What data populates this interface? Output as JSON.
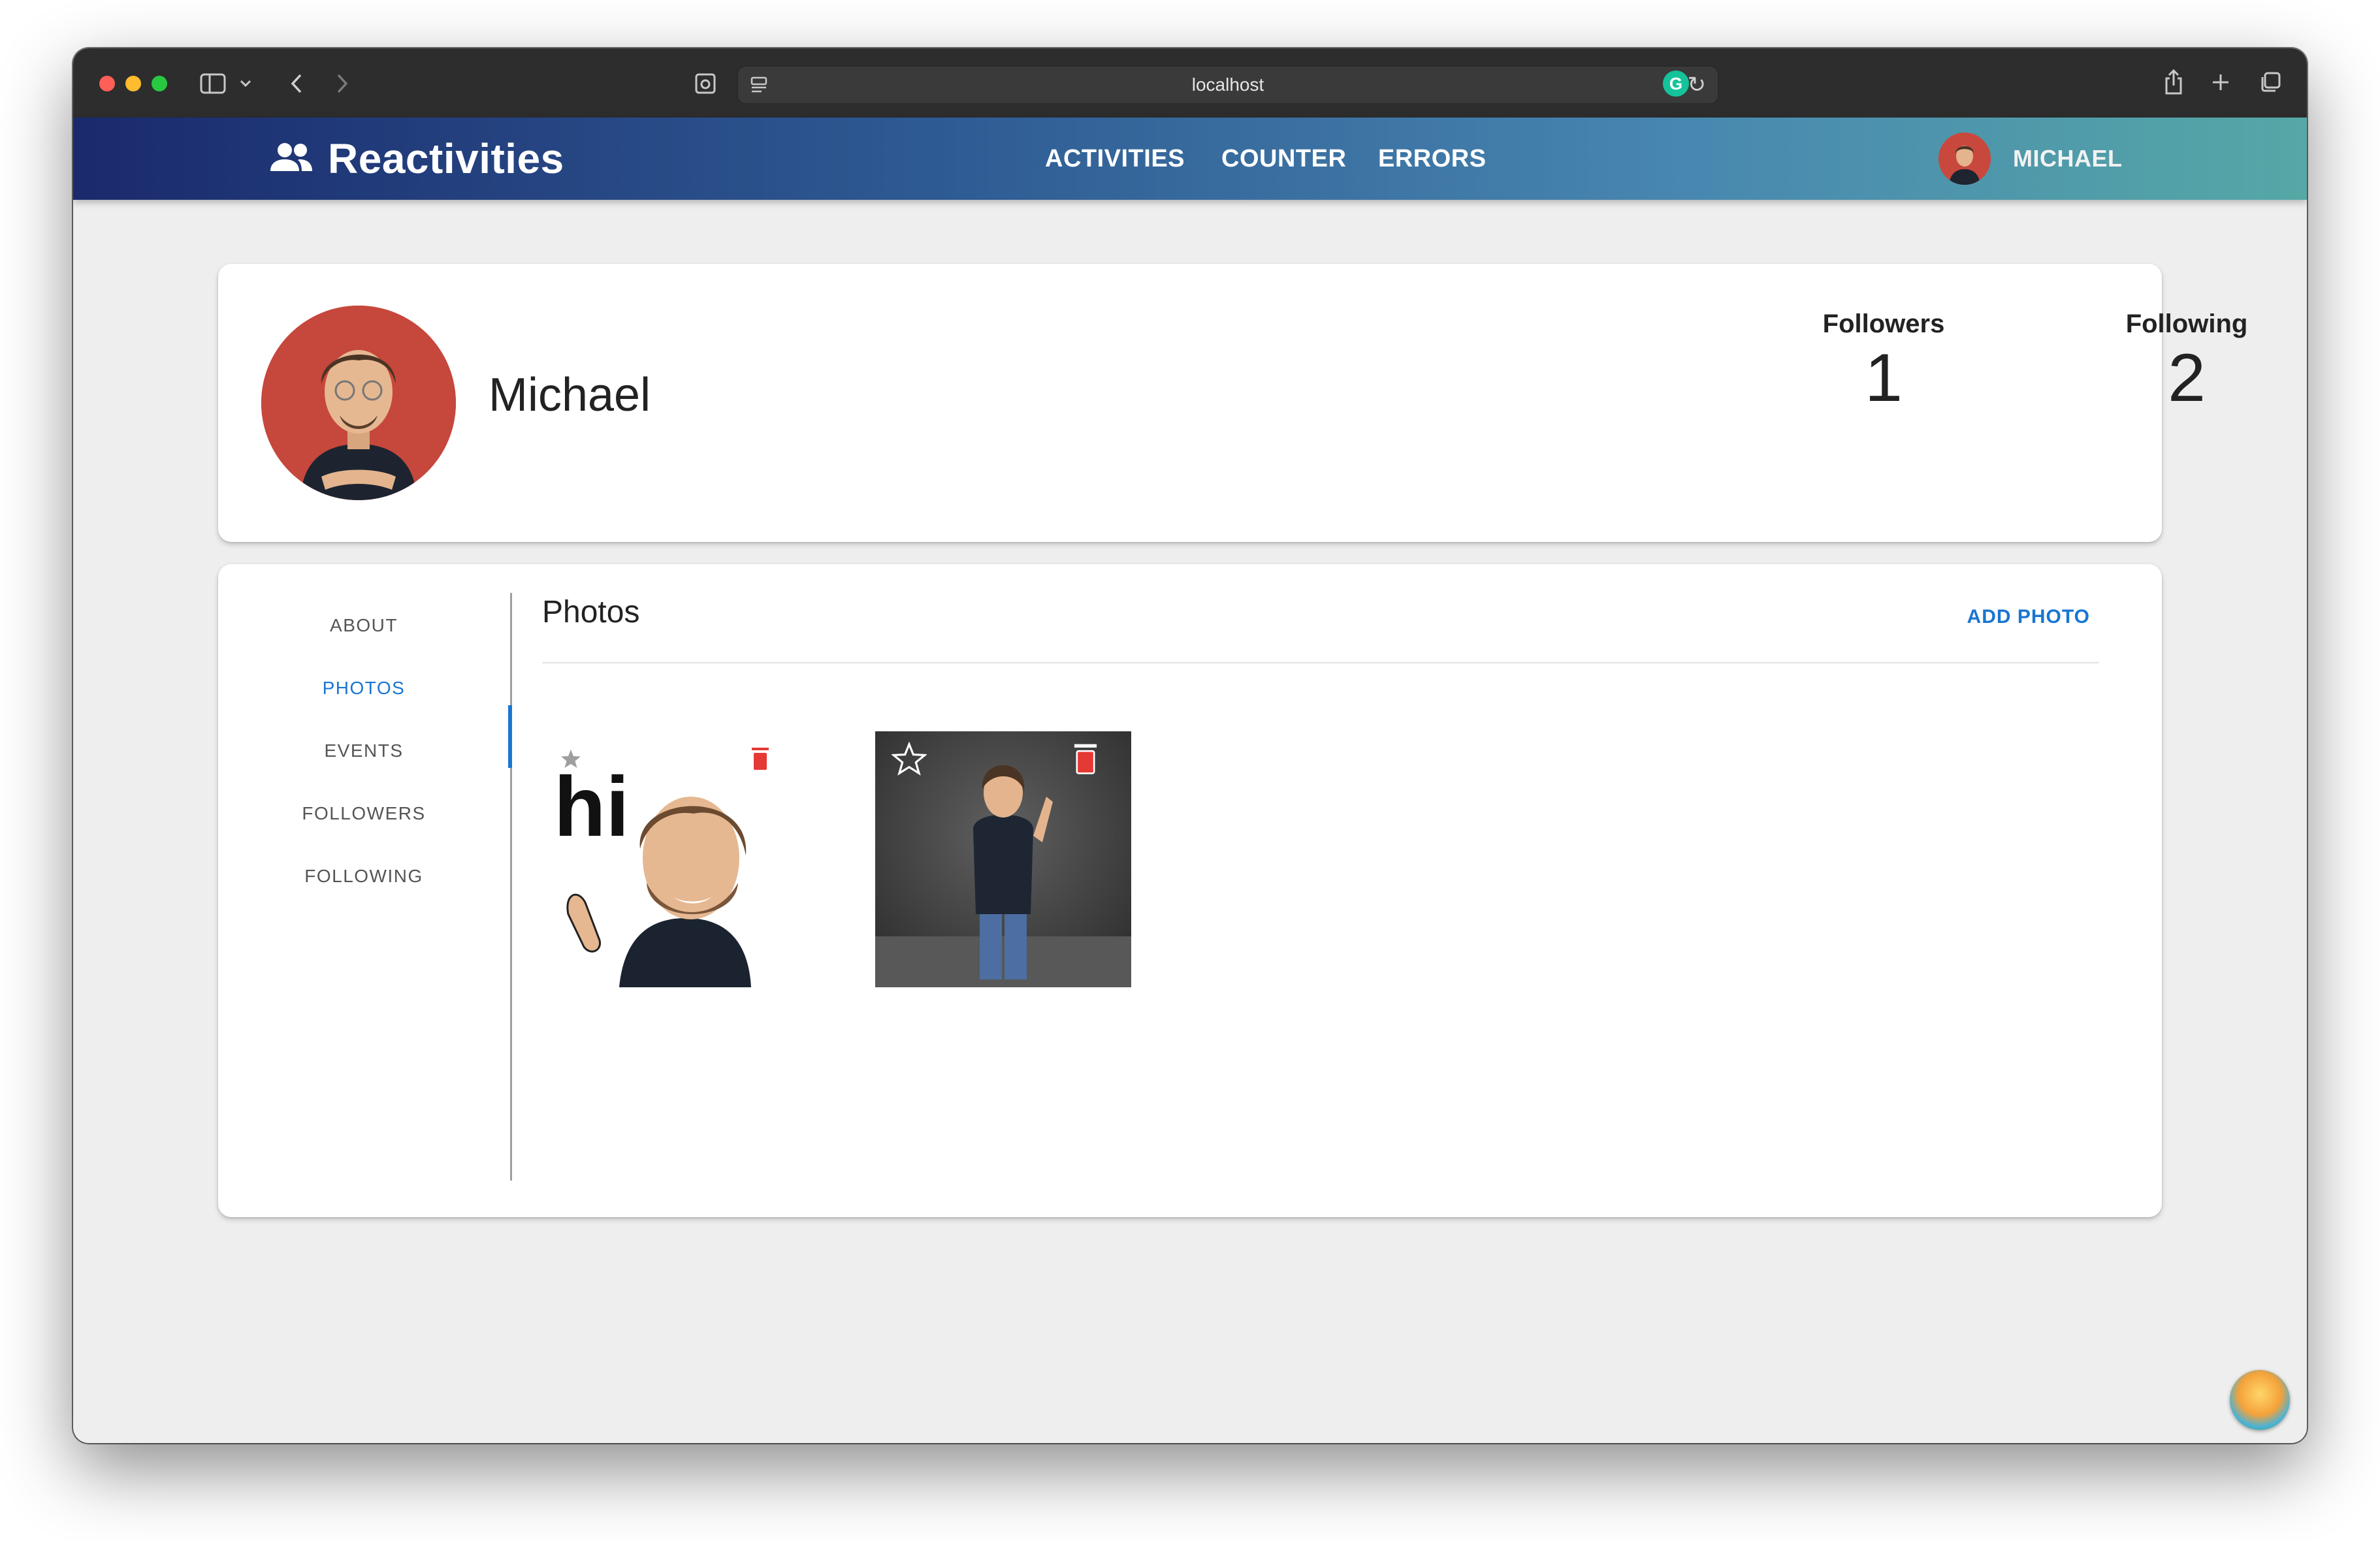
{
  "browser": {
    "address": "localhost"
  },
  "nav": {
    "brand": "Reactivities",
    "links": [
      "ACTIVITIES",
      "COUNTER",
      "ERRORS"
    ],
    "user": "MICHAEL"
  },
  "profile": {
    "name": "Michael",
    "followers_label": "Followers",
    "followers_count": "1",
    "following_label": "Following",
    "following_count": "2"
  },
  "tabs": {
    "items": [
      "ABOUT",
      "PHOTOS",
      "EVENTS",
      "FOLLOWERS",
      "FOLLOWING"
    ],
    "active": "PHOTOS"
  },
  "photos_panel": {
    "title": "Photos",
    "add_label": "ADD PHOTO",
    "photos": [
      {
        "caption_text": "hi",
        "is_main": true
      },
      {
        "caption_text": "",
        "is_main": false
      }
    ]
  },
  "colors": {
    "accent": "#1976d2",
    "delete": "#e53935",
    "nav_gradient_start": "#1a2a6c",
    "nav_gradient_end": "#55a8a6"
  }
}
